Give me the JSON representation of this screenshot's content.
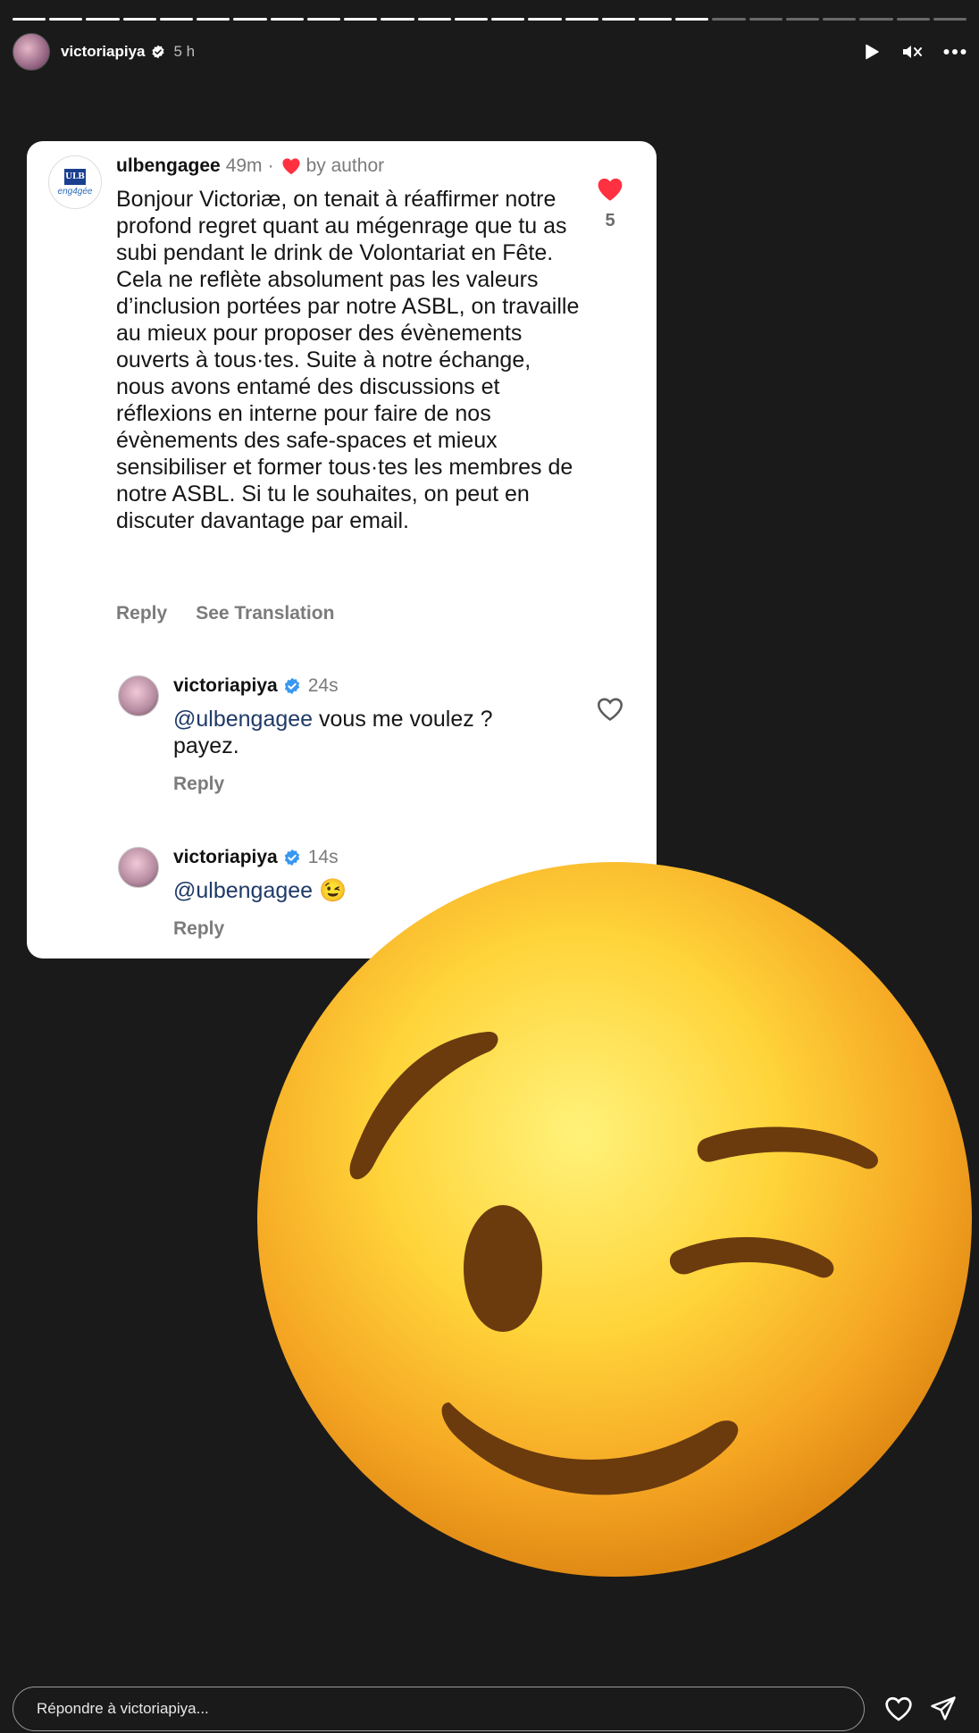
{
  "story": {
    "progress_total": 26,
    "progress_done": 19
  },
  "header": {
    "username": "victoriapiya",
    "time": "5 h",
    "play_icon": "play-icon",
    "mute_icon": "muted-speaker-icon",
    "more_icon": "more-options-icon"
  },
  "comment": {
    "avatar_logo": "ULB",
    "avatar_sub": "eng4gée",
    "username": "ulbengagee",
    "time": "49m",
    "separator": "·",
    "liked_by": "by author",
    "text": "Bonjour Victoriæ, on tenait à réaffirmer notre profond regret quant au mégenrage que tu as subi pendant le drink de Volontariat en Fête. Cela ne reflète absolument pas les valeurs d’inclusion portées par notre ASBL, on travaille au mieux pour proposer des évènements ouverts à tous·tes. Suite à notre échange, nous avons entamé des discussions et réflexions en interne pour faire de nos évènements des safe-spaces et mieux sensibiliser et former tous·tes les membres de notre ASBL. Si tu le souhaites, on peut en discuter davantage par email.",
    "reply_label": "Reply",
    "translate_label": "See Translation",
    "like_count": "5"
  },
  "replies": [
    {
      "username": "victoriapiya",
      "time": "24s",
      "mention": "@ulbengagee",
      "text": " vous me voulez ? payez.",
      "reply_label": "Reply"
    },
    {
      "username": "victoriapiya",
      "time": "14s",
      "mention": "@ulbengagee",
      "text": " 😉",
      "reply_label": "Reply"
    }
  ],
  "sticker": {
    "name": "winking-face-emoji"
  },
  "footer": {
    "placeholder": "Répondre à victoriapiya...",
    "like_icon": "heart-outline-icon",
    "send_icon": "send-icon"
  },
  "colors": {
    "background": "#1a1a1a",
    "like_red": "#ff3040",
    "verified_blue": "#3897f0",
    "mention_blue": "#1f3a68"
  }
}
